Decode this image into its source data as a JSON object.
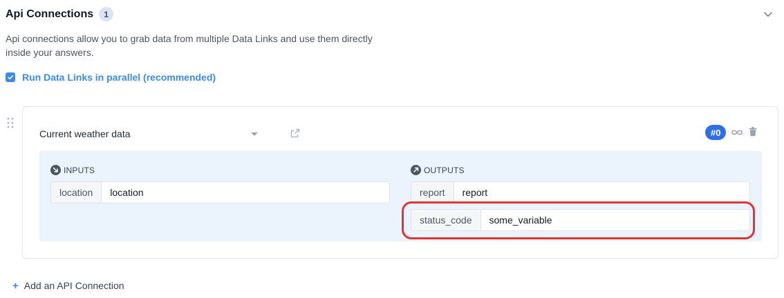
{
  "section": {
    "title": "Api Connections",
    "count": "1",
    "description": "Api connections allow you to grab data from multiple Data Links and use them directly inside your answers.",
    "parallel_label": "Run Data Links in parallel (recommended)",
    "parallel_checked": true
  },
  "connection": {
    "source_value": "Current weather data",
    "index_badge": "#0",
    "inputs_heading": "INPUTS",
    "outputs_heading": "OUTPUTS",
    "inputs": [
      {
        "key": "location",
        "value": "location"
      }
    ],
    "outputs": [
      {
        "key": "report",
        "value": "report"
      },
      {
        "key": "status_code",
        "value": "some_variable"
      }
    ]
  },
  "footer": {
    "add_label": "Add an API Connection",
    "add_symbol": "+"
  },
  "icons": {
    "collapse": "chevron-down-icon",
    "checkbox": "check-icon",
    "drag": "drag-handle-icon",
    "external": "external-link-icon",
    "link": "infinity-link-icon",
    "delete": "trash-icon",
    "inputs": "arrow-in-icon",
    "outputs": "arrow-out-icon"
  },
  "colors": {
    "accent": "#3b8beb",
    "badge_blue": "#2f6fe8",
    "panel_bg": "#ebf3fc",
    "highlight": "#e53232"
  }
}
